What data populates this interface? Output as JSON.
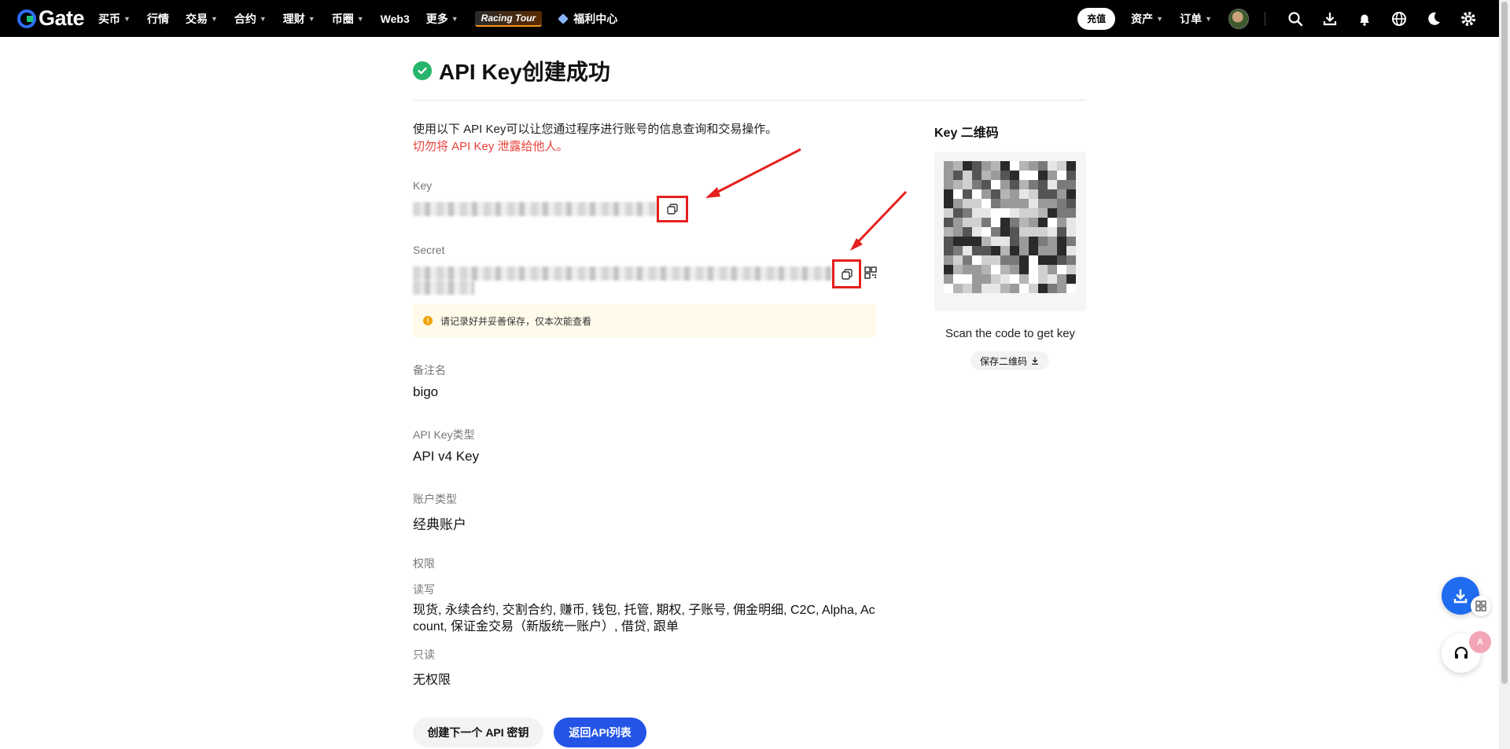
{
  "nav": {
    "brand": "Gate",
    "items": [
      {
        "label": "买币",
        "caret": true
      },
      {
        "label": "行情",
        "caret": false
      },
      {
        "label": "交易",
        "caret": true
      },
      {
        "label": "合约",
        "caret": true
      },
      {
        "label": "理财",
        "caret": true
      },
      {
        "label": "币圈",
        "caret": true
      },
      {
        "label": "Web3",
        "caret": false
      },
      {
        "label": "更多",
        "caret": true
      }
    ],
    "racing_label": "Racing Tour",
    "welfare_label": "福利中心",
    "deposit_label": "充值",
    "assets_label": "资产",
    "orders_label": "订单",
    "right_icons": [
      "search-icon",
      "download-icon",
      "bell-icon",
      "globe-icon",
      "moon-icon",
      "gear-icon"
    ]
  },
  "page": {
    "title": "API Key创建成功",
    "description": "使用以下 API Key可以让您通过程序进行账号的信息查询和交易操作。",
    "warning": "切勿将 API Key 泄露给他人。",
    "key_label": "Key",
    "secret_label": "Secret",
    "notice": "请记录好并妥善保存，仅本次能查看",
    "remark_label": "备注名",
    "remark_value": "bigo",
    "key_type_label": "API Key类型",
    "key_type_value": "API v4 Key",
    "account_type_label": "账户类型",
    "account_type_value": "经典账户",
    "permissions_label": "权限",
    "read_write_label": "读写",
    "read_write_value": "现货, 永续合约, 交割合约, 赚币, 钱包, 托管, 期权, 子账号, 佣金明细, C2C, Alpha, Account, 保证金交易（新版统一账户）, 借贷, 跟单",
    "read_only_label": "只读",
    "read_only_value": "无权限",
    "btn_create_next": "创建下一个 API 密钥",
    "btn_back": "返回API列表"
  },
  "qr": {
    "title": "Key 二维码",
    "caption": "Scan the code to get key",
    "save_label": "保存二维码"
  },
  "colors": {
    "accent": "#2354e6",
    "warning": "#e8403a",
    "success": "#27b46c",
    "highlight": "#e5201e"
  }
}
